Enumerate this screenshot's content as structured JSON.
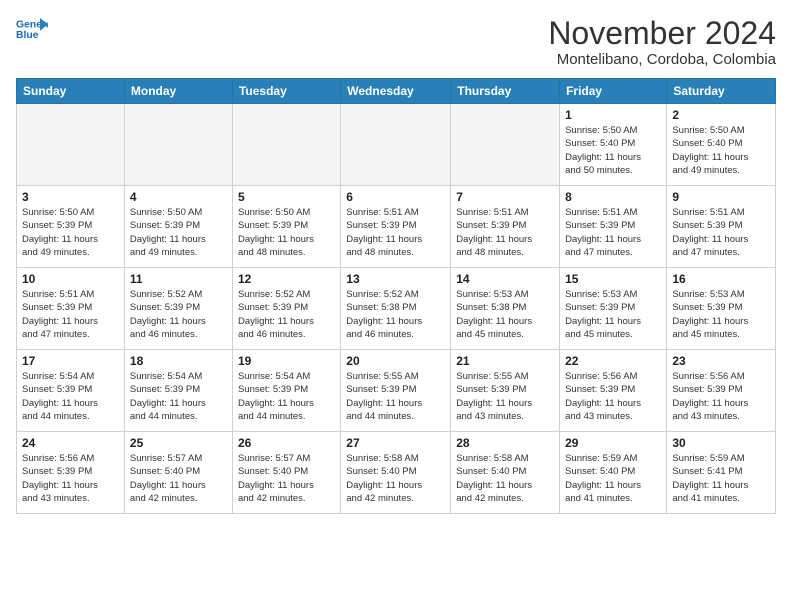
{
  "logo": {
    "line1": "General",
    "line2": "Blue"
  },
  "title": "November 2024",
  "subtitle": "Montelibano, Cordoba, Colombia",
  "weekdays": [
    "Sunday",
    "Monday",
    "Tuesday",
    "Wednesday",
    "Thursday",
    "Friday",
    "Saturday"
  ],
  "weeks": [
    [
      {
        "day": "",
        "info": ""
      },
      {
        "day": "",
        "info": ""
      },
      {
        "day": "",
        "info": ""
      },
      {
        "day": "",
        "info": ""
      },
      {
        "day": "",
        "info": ""
      },
      {
        "day": "1",
        "info": "Sunrise: 5:50 AM\nSunset: 5:40 PM\nDaylight: 11 hours\nand 50 minutes."
      },
      {
        "day": "2",
        "info": "Sunrise: 5:50 AM\nSunset: 5:40 PM\nDaylight: 11 hours\nand 49 minutes."
      }
    ],
    [
      {
        "day": "3",
        "info": "Sunrise: 5:50 AM\nSunset: 5:39 PM\nDaylight: 11 hours\nand 49 minutes."
      },
      {
        "day": "4",
        "info": "Sunrise: 5:50 AM\nSunset: 5:39 PM\nDaylight: 11 hours\nand 49 minutes."
      },
      {
        "day": "5",
        "info": "Sunrise: 5:50 AM\nSunset: 5:39 PM\nDaylight: 11 hours\nand 48 minutes."
      },
      {
        "day": "6",
        "info": "Sunrise: 5:51 AM\nSunset: 5:39 PM\nDaylight: 11 hours\nand 48 minutes."
      },
      {
        "day": "7",
        "info": "Sunrise: 5:51 AM\nSunset: 5:39 PM\nDaylight: 11 hours\nand 48 minutes."
      },
      {
        "day": "8",
        "info": "Sunrise: 5:51 AM\nSunset: 5:39 PM\nDaylight: 11 hours\nand 47 minutes."
      },
      {
        "day": "9",
        "info": "Sunrise: 5:51 AM\nSunset: 5:39 PM\nDaylight: 11 hours\nand 47 minutes."
      }
    ],
    [
      {
        "day": "10",
        "info": "Sunrise: 5:51 AM\nSunset: 5:39 PM\nDaylight: 11 hours\nand 47 minutes."
      },
      {
        "day": "11",
        "info": "Sunrise: 5:52 AM\nSunset: 5:39 PM\nDaylight: 11 hours\nand 46 minutes."
      },
      {
        "day": "12",
        "info": "Sunrise: 5:52 AM\nSunset: 5:39 PM\nDaylight: 11 hours\nand 46 minutes."
      },
      {
        "day": "13",
        "info": "Sunrise: 5:52 AM\nSunset: 5:38 PM\nDaylight: 11 hours\nand 46 minutes."
      },
      {
        "day": "14",
        "info": "Sunrise: 5:53 AM\nSunset: 5:38 PM\nDaylight: 11 hours\nand 45 minutes."
      },
      {
        "day": "15",
        "info": "Sunrise: 5:53 AM\nSunset: 5:39 PM\nDaylight: 11 hours\nand 45 minutes."
      },
      {
        "day": "16",
        "info": "Sunrise: 5:53 AM\nSunset: 5:39 PM\nDaylight: 11 hours\nand 45 minutes."
      }
    ],
    [
      {
        "day": "17",
        "info": "Sunrise: 5:54 AM\nSunset: 5:39 PM\nDaylight: 11 hours\nand 44 minutes."
      },
      {
        "day": "18",
        "info": "Sunrise: 5:54 AM\nSunset: 5:39 PM\nDaylight: 11 hours\nand 44 minutes."
      },
      {
        "day": "19",
        "info": "Sunrise: 5:54 AM\nSunset: 5:39 PM\nDaylight: 11 hours\nand 44 minutes."
      },
      {
        "day": "20",
        "info": "Sunrise: 5:55 AM\nSunset: 5:39 PM\nDaylight: 11 hours\nand 44 minutes."
      },
      {
        "day": "21",
        "info": "Sunrise: 5:55 AM\nSunset: 5:39 PM\nDaylight: 11 hours\nand 43 minutes."
      },
      {
        "day": "22",
        "info": "Sunrise: 5:56 AM\nSunset: 5:39 PM\nDaylight: 11 hours\nand 43 minutes."
      },
      {
        "day": "23",
        "info": "Sunrise: 5:56 AM\nSunset: 5:39 PM\nDaylight: 11 hours\nand 43 minutes."
      }
    ],
    [
      {
        "day": "24",
        "info": "Sunrise: 5:56 AM\nSunset: 5:39 PM\nDaylight: 11 hours\nand 43 minutes."
      },
      {
        "day": "25",
        "info": "Sunrise: 5:57 AM\nSunset: 5:40 PM\nDaylight: 11 hours\nand 42 minutes."
      },
      {
        "day": "26",
        "info": "Sunrise: 5:57 AM\nSunset: 5:40 PM\nDaylight: 11 hours\nand 42 minutes."
      },
      {
        "day": "27",
        "info": "Sunrise: 5:58 AM\nSunset: 5:40 PM\nDaylight: 11 hours\nand 42 minutes."
      },
      {
        "day": "28",
        "info": "Sunrise: 5:58 AM\nSunset: 5:40 PM\nDaylight: 11 hours\nand 42 minutes."
      },
      {
        "day": "29",
        "info": "Sunrise: 5:59 AM\nSunset: 5:40 PM\nDaylight: 11 hours\nand 41 minutes."
      },
      {
        "day": "30",
        "info": "Sunrise: 5:59 AM\nSunset: 5:41 PM\nDaylight: 11 hours\nand 41 minutes."
      }
    ]
  ]
}
